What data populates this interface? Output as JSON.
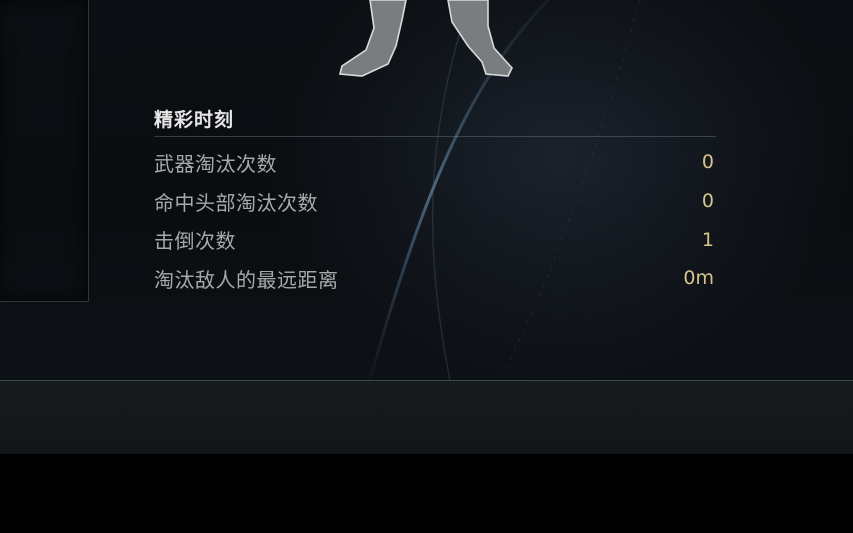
{
  "highlights": {
    "title": "精彩时刻",
    "stats": [
      {
        "label": "武器淘汰次数",
        "value": "0"
      },
      {
        "label": "命中头部淘汰次数",
        "value": "0"
      },
      {
        "label": "击倒次数",
        "value": "1"
      },
      {
        "label": "淘汰敌人的最远距离",
        "value": "0m"
      }
    ]
  },
  "colors": {
    "background": "#0a0c10",
    "title": "#e6e6e6",
    "label": "#a6a9ac",
    "value_accent": "#d8c48a",
    "bottom_bar": "#151a1c"
  }
}
